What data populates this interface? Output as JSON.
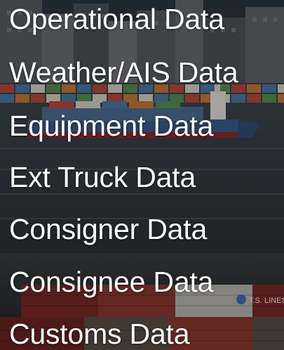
{
  "menu": {
    "items": [
      {
        "label": "Operational Data"
      },
      {
        "label": "Weather/AIS Data"
      },
      {
        "label": "Equipment Data"
      },
      {
        "label": "Ext Truck Data"
      },
      {
        "label": "Consigner Data"
      },
      {
        "label": "Consignee Data"
      },
      {
        "label": "Customs Data"
      }
    ]
  },
  "background": {
    "icon": "port-ship-containers-photo",
    "container_text": "T.S. LINES"
  }
}
